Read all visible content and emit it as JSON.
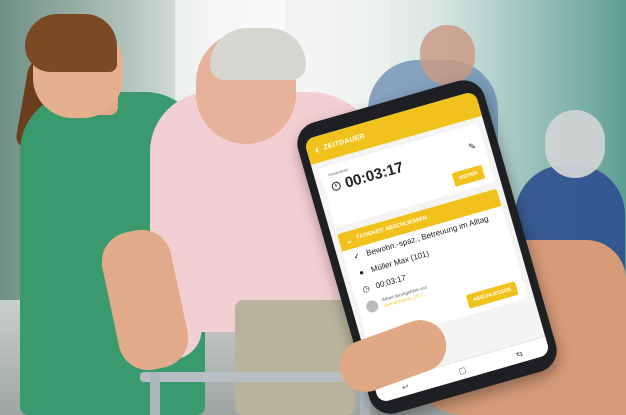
{
  "app": {
    "header": {
      "back_icon": "chevron-left-icon",
      "title": "ZEITDAUER"
    },
    "timer_card": {
      "label": "Gesamtzeit",
      "time": "00:03:17",
      "continue_button": "WEITER"
    },
    "finish_section": {
      "title": "TÄTIGKEIT ABSCHLIESSEN",
      "activity": "Bewohn.-spaz., Betreuung im Alltag",
      "resident": "Müller Max (101)",
      "duration": "00:03:17",
      "performed_by_text": "Arbeit durchgeführt von",
      "performed_by_user": "vivendi tracker, 2017",
      "finish_button": "ABSCHLIESSEN"
    },
    "navbar": {
      "back": "↩",
      "home": "▢",
      "recent": "⇆"
    }
  },
  "colors": {
    "accent": "#f1c21b",
    "scrub_green": "#3a9a6d"
  }
}
